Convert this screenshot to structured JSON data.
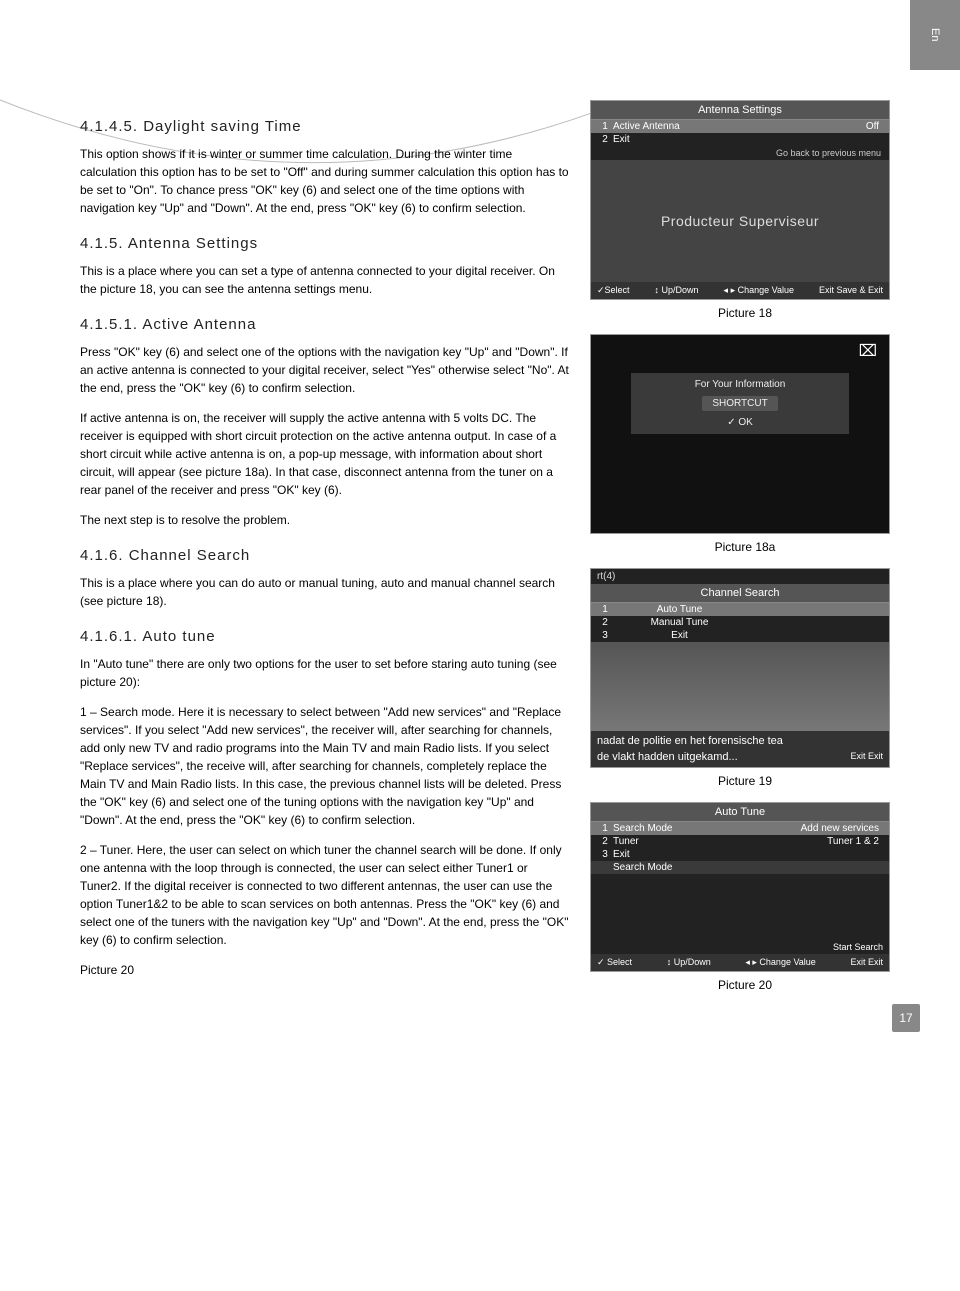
{
  "lang_tab": "En",
  "page_number": "17",
  "sections": {
    "s1": {
      "title": "4.1.4.5. Daylight saving Time",
      "p1": "This option shows if it is winter or summer time calculation. During the winter time calculation this option has to be set to \"Off\" and during summer calculation this option has to be set to \"On\". To chance press \"OK\" key (6) and select one of the time options with navigation key \"Up\" and \"Down\". At the end, press \"OK\" key (6) to confirm selection."
    },
    "s2": {
      "title": "4.1.5. Antenna Settings",
      "p1": "This is a place where you can set a type of antenna connected to your digital receiver. On the picture 18, you can see the antenna settings menu."
    },
    "s3": {
      "title": "4.1.5.1. Active Antenna",
      "p1": "Press \"OK\" key (6) and select one of the options with the navigation key \"Up\" and \"Down\". If an active antenna is connected to your digital receiver, select \"Yes\" otherwise select \"No\". At the end, press the \"OK\" key (6) to confirm selection.",
      "p2": "If active antenna is on, the receiver will supply the active antenna with 5 volts DC. The receiver is equipped with short circuit protection on the active antenna output. In case of a short circuit while active antenna is on, a pop-up message, with information about short circuit, will appear (see picture 18a). In that case, disconnect antenna from the tuner on a rear panel of the receiver and press \"OK\" key (6).",
      "p3": "The next step is to resolve the problem."
    },
    "s4": {
      "title": "4.1.6. Channel  Search",
      "p1": "This is a place where you can do auto or manual tuning, auto and manual channel search (see picture 18)."
    },
    "s5": {
      "title": "4.1.6.1. Auto tune",
      "p1": "In \"Auto tune\" there are only two options for the user to set before staring auto tuning (see picture 20):",
      "p2": "1 – Search mode. Here it is necessary to select between \"Add new services\" and \"Replace services\". If you select \"Add new services\", the receiver will, after searching for channels, add only new TV and radio programs into the Main TV and main Radio lists. If you select \"Replace services\", the receive will, after searching for channels, completely replace the Main TV and Main Radio lists.  In this case, the previous channel lists will be deleted.  Press the \"OK\" key (6) and select one of the tuning options with the navigation key \"Up\" and \"Down\".  At the end, press the \"OK\" key (6) to confirm selection.",
      "p3": "2 – Tuner. Here, the user can select on which tuner the channel search will be done.  If only one antenna with the loop through is connected, the user can select either Tuner1 or Tuner2.  If the digital receiver is connected to two different antennas, the user can use the option Tuner1&2 to be able to scan services on both antennas.  Press the \"OK\" key (6) and select one of the tuners with the navigation key \"Up\" and \"Down\".  At the end, press the \"OK\" key (6) to confirm selection.",
      "p4": "Picture 20"
    }
  },
  "figures": {
    "f18": {
      "caption": "Picture 18",
      "title": "Antenna Settings",
      "rows": [
        {
          "n": "1",
          "label": "Active Antenna",
          "val": "Off"
        },
        {
          "n": "2",
          "label": "Exit",
          "val": ""
        }
      ],
      "back": "Go back to previous menu",
      "body": "Producteur  Superviseur",
      "foot": {
        "a": "✓Select",
        "b": "↕ Up/Down",
        "c": "◂ ▸ Change Value",
        "d": "Exit Save & Exit"
      }
    },
    "f18a": {
      "caption": "Picture 18a",
      "info_title": "For Your Information",
      "info_sub": "SHORTCUT",
      "info_ok": "✓ OK"
    },
    "f19": {
      "caption": "Picture 19",
      "overlay": "rt(4)",
      "title": "Channel Search",
      "rows": [
        {
          "n": "1",
          "label": "Auto Tune"
        },
        {
          "n": "2",
          "label": "Manual Tune"
        },
        {
          "n": "3",
          "label": "Exit"
        }
      ],
      "sub1": "nadat de politie en het forensische tea",
      "sub2": "de vlakt hadden uitgekamd...",
      "foot_exit": "Exit Exit"
    },
    "f20": {
      "caption": "Picture 20",
      "title": "Auto Tune",
      "rows": [
        {
          "n": "1",
          "label": "Search Mode",
          "val": "Add new services"
        },
        {
          "n": "2",
          "label": "Tuner",
          "val": "Tuner 1 & 2"
        },
        {
          "n": "3",
          "label": "Exit",
          "val": ""
        }
      ],
      "extra": "Search Mode",
      "foot": {
        "a": "✓ Select",
        "b": "↕ Up/Down",
        "c": "◂ ▸ Change Value",
        "d": "Start Search",
        "e": "Exit Exit"
      }
    }
  }
}
